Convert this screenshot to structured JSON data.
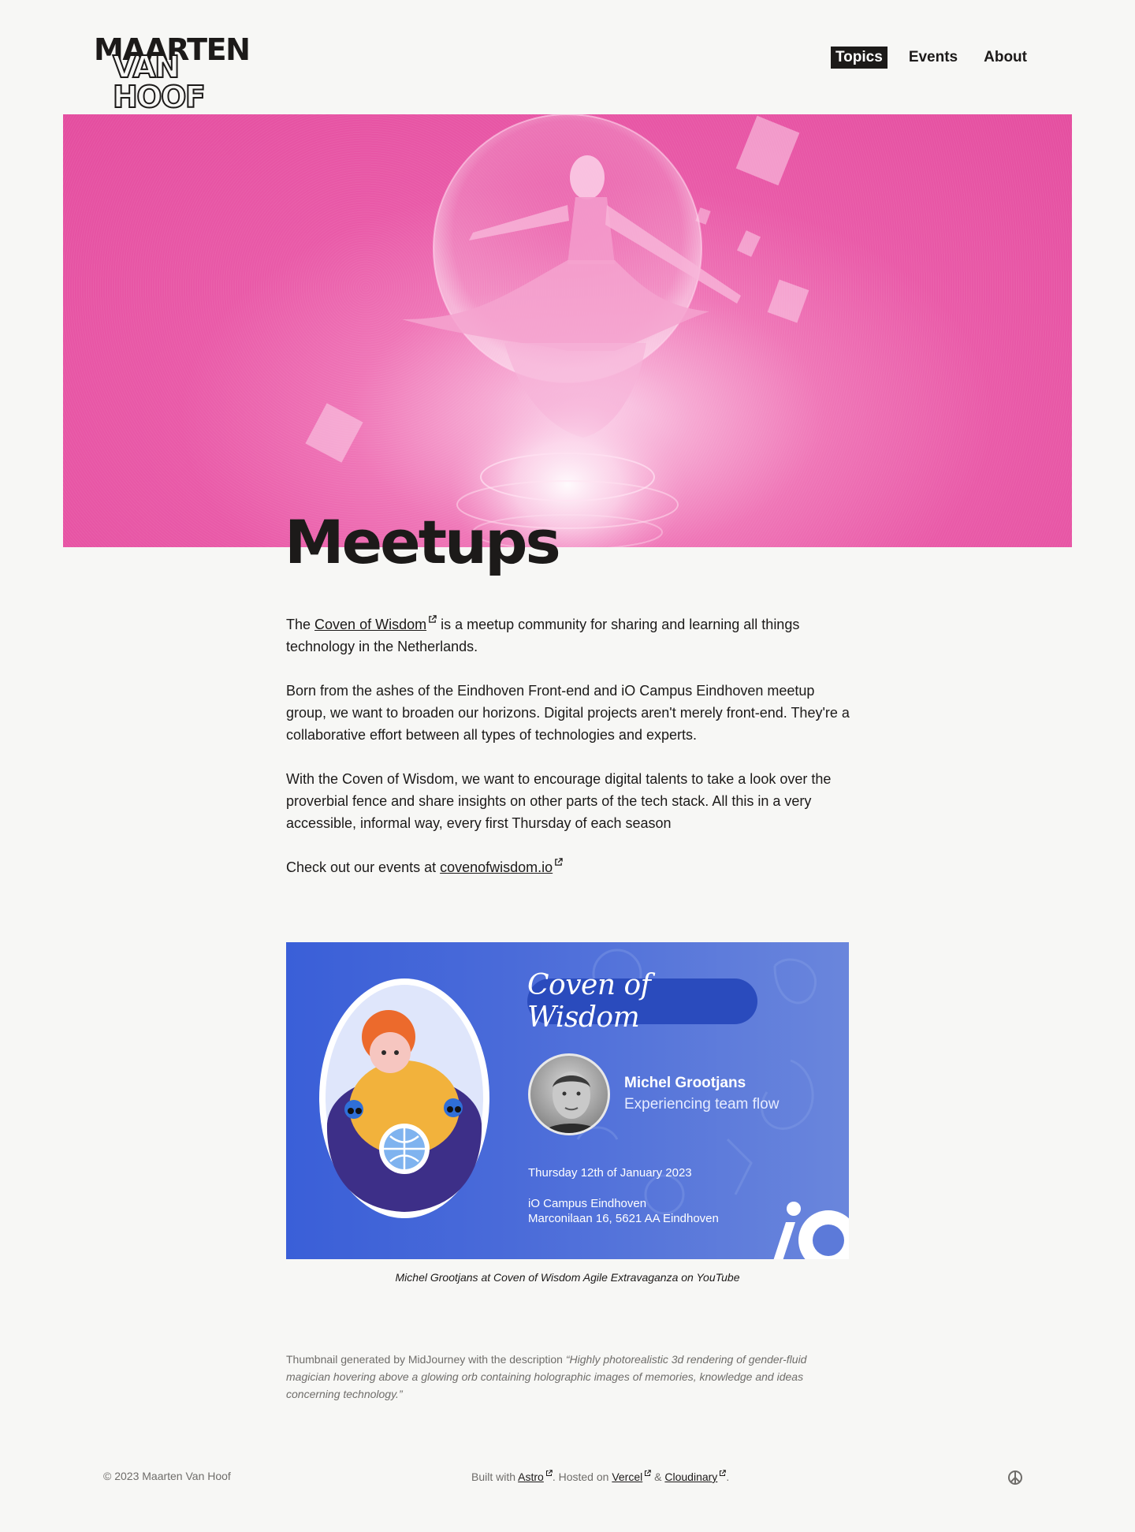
{
  "header": {
    "logo_line1": "MAARTEN",
    "logo_line2": "VAN HOOF",
    "nav": [
      {
        "label": "Topics",
        "active": true
      },
      {
        "label": "Events",
        "active": false
      },
      {
        "label": "About",
        "active": false
      }
    ]
  },
  "page": {
    "title": "Meetups"
  },
  "content": {
    "p1_prefix": "The ",
    "p1_link": "Coven of Wisdom",
    "p1_suffix": " is a meetup community for sharing and learning all things technology in the Netherlands.",
    "p2": "Born from the ashes of the Eindhoven Front-end and iO Campus Eindhoven meetup group, we want to broaden our horizons. Digital projects aren't merely front-end. They're a collaborative effort between all types of technologies and experts.",
    "p3": "With the Coven of Wisdom, we want to encourage digital talents to take a look over the proverbial fence and share insights on other parts of the tech stack. All this in a very accessible, informal way, every first Thursday of each season",
    "p4_prefix": "Check out our events at ",
    "p4_link": "covenofwisdom.io"
  },
  "video": {
    "pill": "Coven of Wisdom",
    "speaker_name": "Michel Grootjans",
    "talk_title": "Experiencing team flow",
    "date": "Thursday 12th of January 2023",
    "venue": "iO Campus Eindhoven",
    "address": "Marconilaan 16, 5621 AA Eindhoven",
    "caption": "Michel Grootjans at Coven of Wisdom Agile Extravaganza on YouTube"
  },
  "credit": {
    "prefix": "Thumbnail generated by MidJourney with the description ",
    "quote": "“Highly photorealistic 3d rendering of gender-fluid magician hovering above a glowing orb containing holographic images of memories, knowledge and ideas concerning technology.”"
  },
  "footer": {
    "copyright": "© 2023 Maarten Van Hoof",
    "built_with": "Built with ",
    "astro": "Astro",
    "hosted_on": ". Hosted on ",
    "vercel": "Vercel",
    "amp": " & ",
    "cloudinary": "Cloudinary",
    "period": ".",
    "peace_icon": "peace-icon"
  },
  "colors": {
    "background": "#f7f7f5",
    "text": "#1c1a19",
    "hero_pink": "#e95aa8",
    "card_blue": "#3a5fd8"
  }
}
